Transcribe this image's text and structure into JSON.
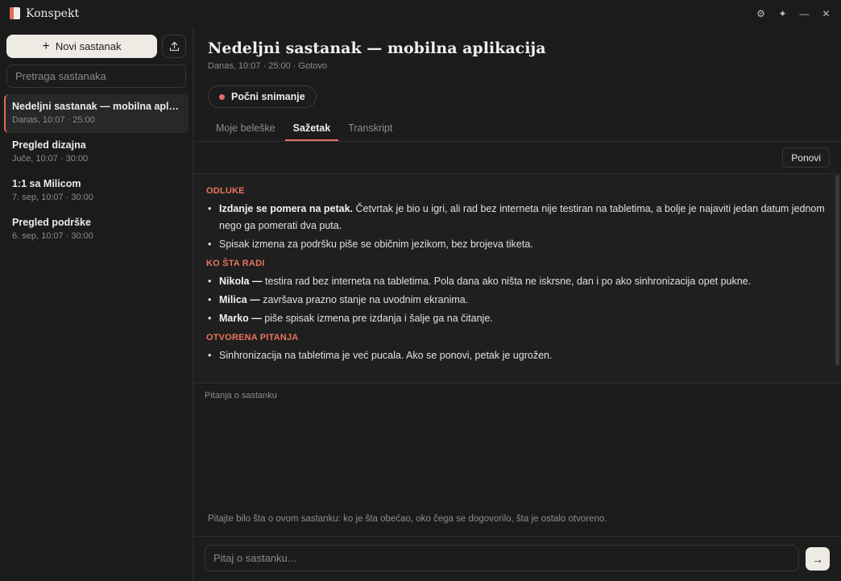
{
  "app": {
    "name": "Konspekt",
    "controls": {
      "settings": "⚙",
      "sparkle": "✦",
      "minimize": "—",
      "close": "✕"
    }
  },
  "sidebar": {
    "new_label": "Novi sastanak",
    "search_placeholder": "Pretraga sastanaka",
    "meetings": [
      {
        "title": "Nedeljni sastanak — mobilna aplikacija",
        "meta": "Danas, 10:07 · 25:00",
        "active": true
      },
      {
        "title": "Pregled dizajna",
        "meta": "Juče, 10:07 · 30:00",
        "active": false
      },
      {
        "title": "1:1 sa Milicom",
        "meta": "7. sep, 10:07 · 30:00",
        "active": false
      },
      {
        "title": "Pregled podrške",
        "meta": "6. sep, 10:07 · 30:00",
        "active": false
      }
    ]
  },
  "main": {
    "title": "Nedeljni sastanak — mobilna aplikacija",
    "meta": "Danas, 10:07 · 25:00 · Gotovo",
    "record_label": "Počni snimanje",
    "tabs": [
      {
        "label": "Moje beleške",
        "active": false
      },
      {
        "label": "Sažetak",
        "active": true
      },
      {
        "label": "Transkript",
        "active": false
      }
    ],
    "repeat_label": "Ponovi",
    "summary": {
      "decisions": {
        "title": "ODLUKE",
        "items": [
          {
            "bold": "Izdanje se pomera na petak.",
            "text": " Četvrtak je bio u igri, ali rad bez interneta nije testiran na tabletima, a bolje je najaviti jedan datum jednom nego ga pomerati dva puta."
          },
          {
            "bold": "",
            "text": "Spisak izmena za podršku piše se običnim jezikom, bez brojeva tiketa."
          }
        ]
      },
      "who": {
        "title": "KO ŠTA RADI",
        "items": [
          {
            "bold": "Nikola —",
            "text": " testira rad bez interneta na tabletima. Pola dana ako ništa ne iskrsne, dan i po ako sinhronizacija opet pukne."
          },
          {
            "bold": "Milica —",
            "text": " završava prazno stanje na uvodnim ekranima."
          },
          {
            "bold": "Marko —",
            "text": " piše spisak izmena pre izdanja i šalje ga na čitanje."
          }
        ]
      },
      "open": {
        "title": "OTVORENA PITANJA",
        "items": [
          {
            "bold": "",
            "text": "Sinhronizacija na tabletima je već pucala. Ako se ponovi, petak je ugrožen."
          }
        ]
      }
    },
    "qa_label": "Pitanja o sastanku",
    "qa_hint": "Pitajte bilo šta o ovom sastanku: ko je šta obećao, oko čega se dogovorilo, šta je ostalo otvoreno.",
    "ask_placeholder": "Pitaj o sastanku...",
    "send_icon": "→"
  }
}
